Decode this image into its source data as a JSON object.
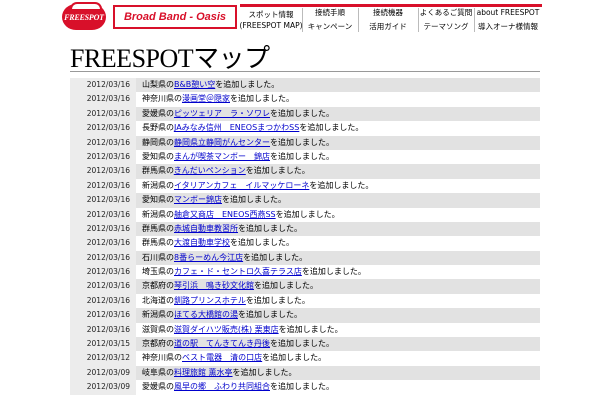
{
  "header": {
    "logo_text": "FREESPOT",
    "brand": "Broad Band - Oasis",
    "nav": [
      {
        "line1": "スポット情報",
        "line2": "(FREESPOT MAP)"
      },
      {
        "top": "接続手順",
        "bottom": "キャンペーン"
      },
      {
        "top": "接続機器",
        "bottom": "活用ガイド"
      },
      {
        "top": "よくあるご質問",
        "bottom": "テーマソング"
      },
      {
        "top": "about FREESPOT",
        "bottom": "導入オーナ様情報"
      }
    ]
  },
  "page": {
    "title": "FREESPOTマップ"
  },
  "entries": [
    {
      "date": "2012/03/16",
      "pref": "山梨県の",
      "link": "B&B憩い空",
      "suffix": "を追加しました。"
    },
    {
      "date": "2012/03/16",
      "pref": "神奈川県の",
      "link": "漫画堂＠隠家",
      "suffix": "を追加しました。"
    },
    {
      "date": "2012/03/16",
      "pref": "愛媛県の",
      "link": "ピッツェリア　ラ・ソワレ",
      "suffix": "を追加しました。"
    },
    {
      "date": "2012/03/16",
      "pref": "長野県の",
      "link": "JAみなみ信州　ENEOSまつかわSS",
      "suffix": "を追加しました。"
    },
    {
      "date": "2012/03/16",
      "pref": "静岡県の",
      "link": "静岡県立静岡がんセンター",
      "suffix": "を追加しました。"
    },
    {
      "date": "2012/03/16",
      "pref": "愛知県の",
      "link": "まんが喫茶マンボー　錦店",
      "suffix": "を追加しました。"
    },
    {
      "date": "2012/03/16",
      "pref": "群馬県の",
      "link": "きんだいペンション",
      "suffix": "を追加しました。"
    },
    {
      "date": "2012/03/16",
      "pref": "新潟県の",
      "link": "イタリアンカフェ　イルマッケローネ",
      "suffix": "を追加しました。"
    },
    {
      "date": "2012/03/16",
      "pref": "愛知県の",
      "link": "マンボー錦店",
      "suffix": "を追加しました。"
    },
    {
      "date": "2012/03/16",
      "pref": "新潟県の",
      "link": "舳倉又商店　ENEOS西燕SS",
      "suffix": "を追加しました。"
    },
    {
      "date": "2012/03/16",
      "pref": "群馬県の",
      "link": "赤城自動車教習所",
      "suffix": "を追加しました。"
    },
    {
      "date": "2012/03/16",
      "pref": "群馬県の",
      "link": "大渡自動車学校",
      "suffix": "を追加しました。"
    },
    {
      "date": "2012/03/16",
      "pref": "石川県の",
      "link": "8番らーめん今江店",
      "suffix": "を追加しました。"
    },
    {
      "date": "2012/03/16",
      "pref": "埼玉県の",
      "link": "カフェ・ド・セントロ久喜テラス店",
      "suffix": "を追加しました。"
    },
    {
      "date": "2012/03/16",
      "pref": "京都府の",
      "link": "琴引浜　鳴き砂文化館",
      "suffix": "を追加しました。"
    },
    {
      "date": "2012/03/16",
      "pref": "北海道の",
      "link": "釧路プリンスホテル",
      "suffix": "を追加しました。"
    },
    {
      "date": "2012/03/16",
      "pref": "新潟県の",
      "link": "ほてる大橋館の湯",
      "suffix": "を追加しました。"
    },
    {
      "date": "2012/03/16",
      "pref": "滋賀県の",
      "link": "滋賀ダイハツ販売(株) 栗東店",
      "suffix": "を追加しました。"
    },
    {
      "date": "2012/03/15",
      "pref": "京都府の",
      "link": "道の駅　てんきてんき丹後",
      "suffix": "を追加しました。"
    },
    {
      "date": "2012/03/12",
      "pref": "神奈川県の",
      "link": "ベスト電器　清の口店",
      "suffix": "を追加しました。"
    },
    {
      "date": "2012/03/09",
      "pref": "岐阜県の",
      "link": "料理旅館 薫水亭",
      "suffix": "を追加しました。"
    },
    {
      "date": "2012/03/09",
      "pref": "愛媛県の",
      "link": "風早の郷　ふわり共同組合",
      "suffix": "を追加しました。"
    }
  ]
}
